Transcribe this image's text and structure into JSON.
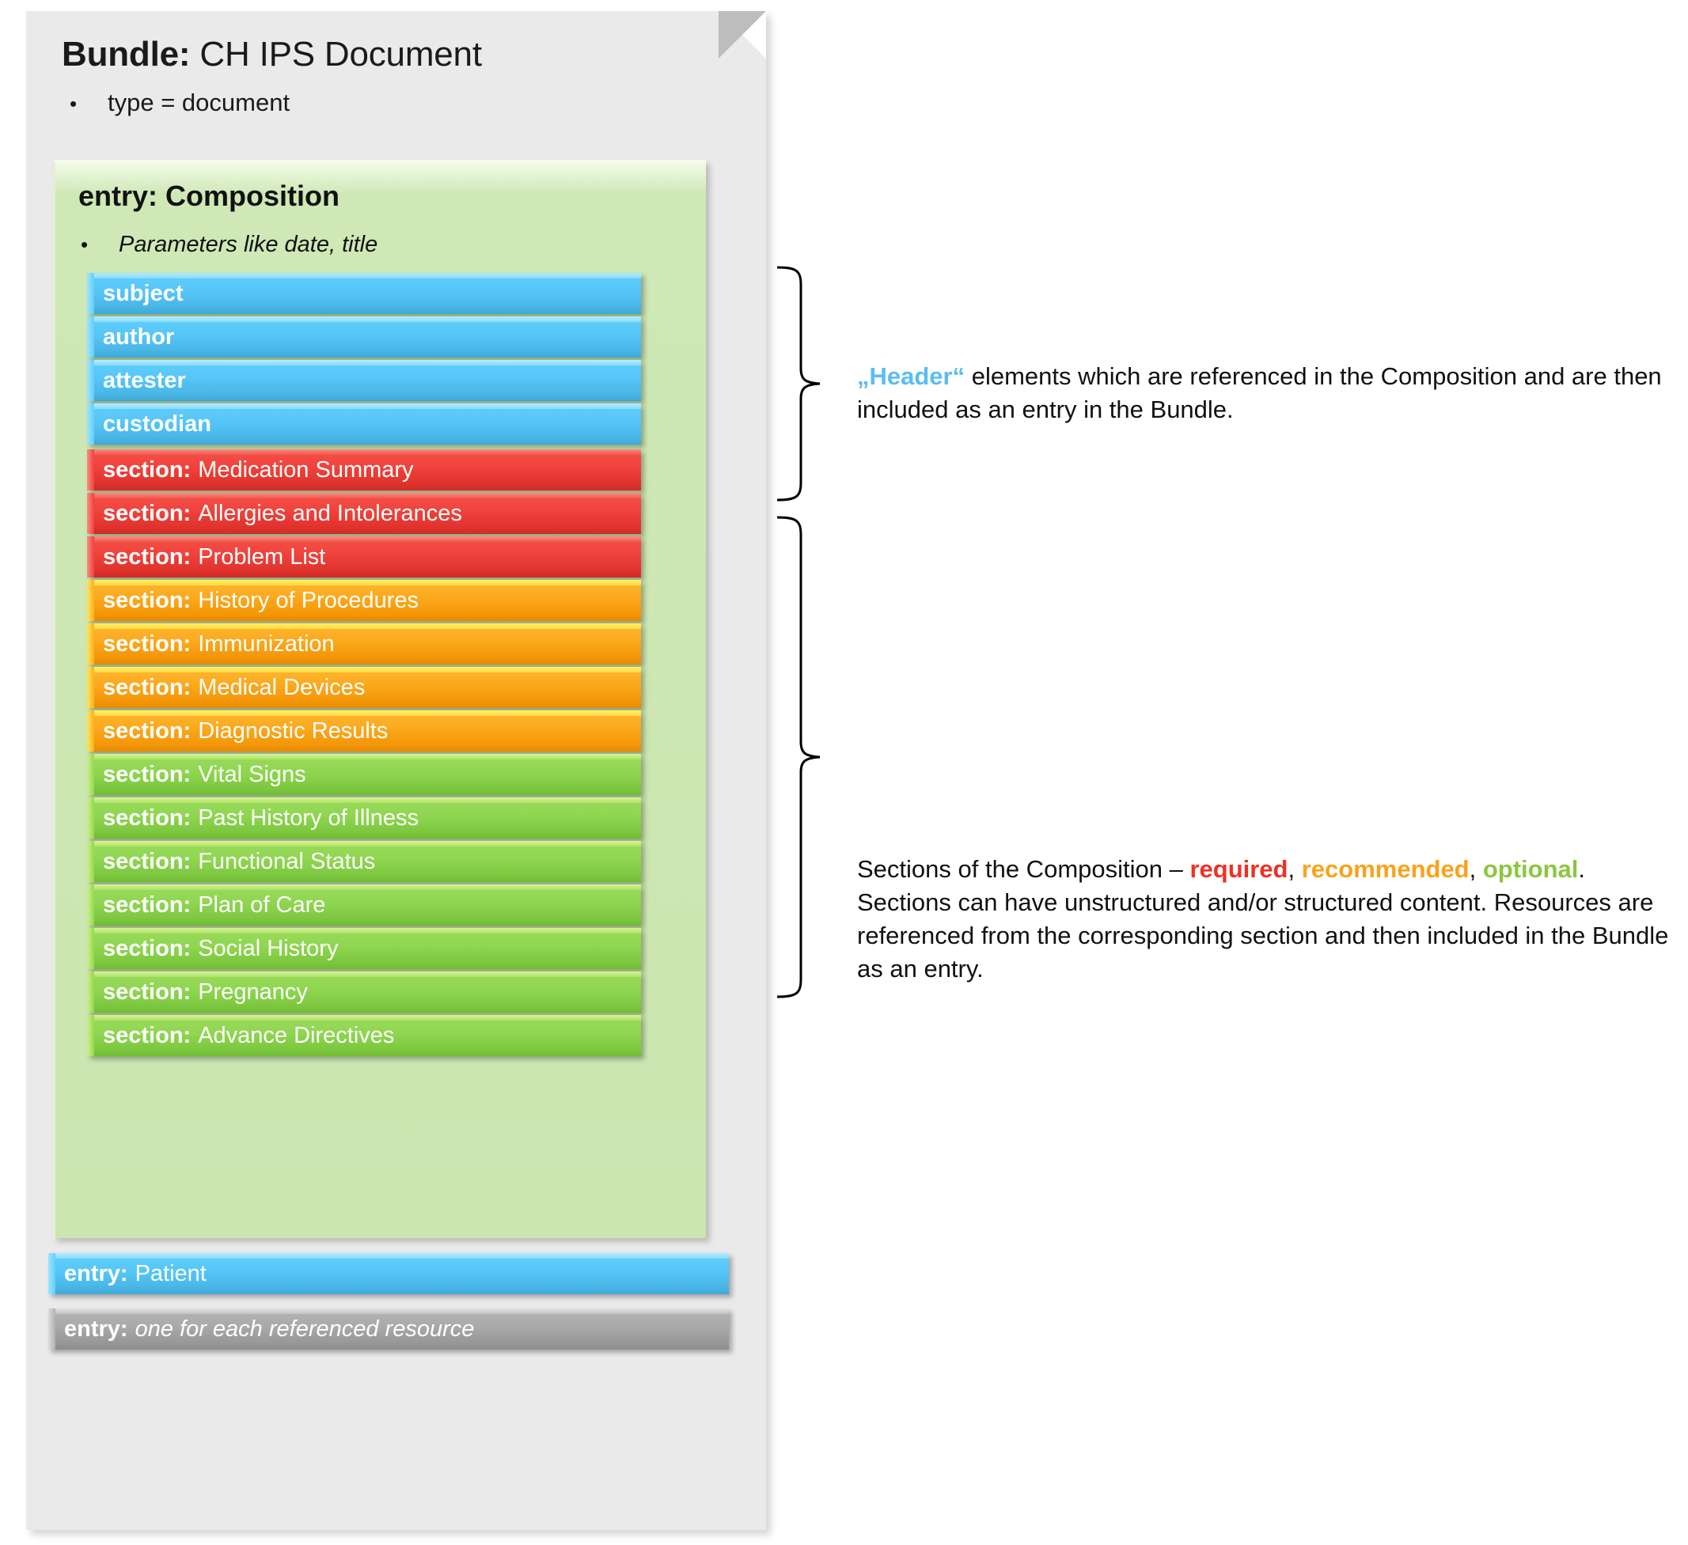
{
  "bundle": {
    "title_key": "Bundle:",
    "title_value": "CH IPS Document",
    "bullets": [
      "type = document"
    ]
  },
  "composition": {
    "title": "entry: Composition",
    "bullets": [
      "Parameters like date, title"
    ],
    "header_elements": [
      {
        "label": "subject",
        "color": "blue"
      },
      {
        "label": "author",
        "color": "blue"
      },
      {
        "label": "attester",
        "color": "blue"
      },
      {
        "label": "custodian",
        "color": "blue"
      }
    ],
    "sections_key": "section:",
    "sections": [
      {
        "name": "Medication Summary",
        "color": "red",
        "level": "required"
      },
      {
        "name": "Allergies and Intolerances",
        "color": "red",
        "level": "required"
      },
      {
        "name": "Problem List",
        "color": "red",
        "level": "required"
      },
      {
        "name": "History of Procedures",
        "color": "orange",
        "level": "recommended"
      },
      {
        "name": "Immunization",
        "color": "orange",
        "level": "recommended"
      },
      {
        "name": "Medical Devices",
        "color": "orange",
        "level": "recommended"
      },
      {
        "name": "Diagnostic Results",
        "color": "orange",
        "level": "recommended"
      },
      {
        "name": "Vital Signs",
        "color": "green",
        "level": "optional"
      },
      {
        "name": "Past History of Illness",
        "color": "green",
        "level": "optional"
      },
      {
        "name": "Functional Status",
        "color": "green",
        "level": "optional"
      },
      {
        "name": "Plan of Care",
        "color": "green",
        "level": "optional"
      },
      {
        "name": "Social History",
        "color": "green",
        "level": "optional"
      },
      {
        "name": "Pregnancy",
        "color": "green",
        "level": "optional"
      },
      {
        "name": "Advance Directives",
        "color": "green",
        "level": "optional"
      }
    ]
  },
  "bundle_entries": [
    {
      "key": "entry:",
      "value": "Patient",
      "color": "blue",
      "italic": false
    },
    {
      "key": "entry:",
      "value": "one for each referenced resource",
      "color": "grey",
      "italic": true
    }
  ],
  "annotations": {
    "header": {
      "keyword": "„Header“",
      "rest": " elements which are referenced in the Composition and are then included as an entry in the Bundle."
    },
    "sections": {
      "lead": "Sections of the Composition – ",
      "kw_required": "required",
      "sep1": ", ",
      "kw_recommended": "recommended",
      "sep2": ", ",
      "kw_optional": "optional",
      "tail": ". Sections can have unstructured and/or structured content. Resources are referenced from the corresponding section and then included in the Bundle as an entry."
    }
  },
  "colors": {
    "blue": "#55c6f7",
    "red": "#f0423c",
    "orange": "#fca91e",
    "green": "#8fd651",
    "grey": "#a9a9a9",
    "panel_green": "#cbe6b1",
    "sheet": "#eaeaea"
  }
}
